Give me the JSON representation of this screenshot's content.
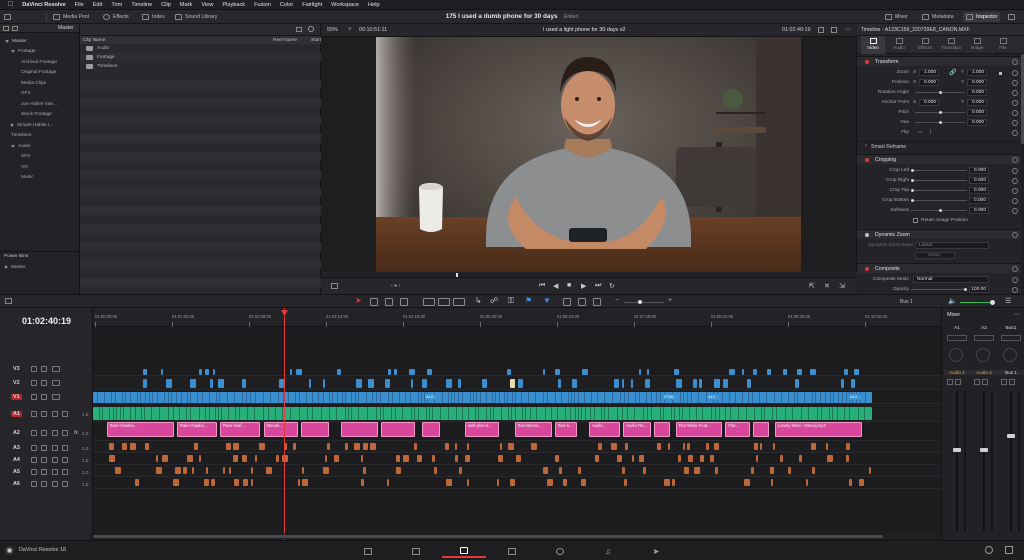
{
  "menubar": {
    "app": "DaVinci Resolve",
    "items": [
      "File",
      "Edit",
      "Trim",
      "Timeline",
      "Clip",
      "Mark",
      "View",
      "Playback",
      "Fusion",
      "Color",
      "Fairlight",
      "Workspace",
      "Help"
    ]
  },
  "toolbar": {
    "media_pool": "Media Pool",
    "effects": "Effects",
    "index": "Index",
    "sound_library": "Sound Library",
    "project_title": "175 I used a dumb phone for 30 days",
    "project_status": "Edited",
    "mixer": "Mixer",
    "metadata": "Metadata",
    "inspector": "Inspector"
  },
  "bins": {
    "header": "Master",
    "tree": [
      {
        "label": "Master",
        "level": 0,
        "open": true
      },
      {
        "label": "Footage",
        "level": 1,
        "open": true
      },
      {
        "label": "Archival Footage",
        "level": 2
      },
      {
        "label": "Original Footage",
        "level": 2
      },
      {
        "label": "Media Clips",
        "level": 2
      },
      {
        "label": "GFX",
        "level": 2
      },
      {
        "label": "Joe Hollier Inte...",
        "level": 2
      },
      {
        "label": "Stock Footage",
        "level": 2
      },
      {
        "label": "Simple Habits I...",
        "level": 1,
        "open": false
      },
      {
        "label": "Timelines",
        "level": 1
      },
      {
        "label": "Audio",
        "level": 1,
        "open": true
      },
      {
        "label": "SFX",
        "level": 2
      },
      {
        "label": "VO",
        "level": 2
      },
      {
        "label": "Music",
        "level": 2
      }
    ],
    "power_bins_label": "Power Bins",
    "power_bins_master": "Master"
  },
  "pool": {
    "columns": [
      "Clip Name",
      "Reel Name",
      "Start"
    ],
    "rows": [
      "Audio",
      "Footage",
      "Timelines"
    ]
  },
  "viewer": {
    "zoom": "55%",
    "timecode_left": "00:10:51:11",
    "timeline_name": "I used a light phone for 30 days v2",
    "timecode_right": "01:02:40:19",
    "zoom_options": "Fit"
  },
  "inspector": {
    "clip_title": "Timeline - A123C159_220729E8_CANON.MXF",
    "tabs": [
      "Video",
      "Audio",
      "Effects",
      "Transition",
      "Image",
      "File"
    ],
    "transform": {
      "header": "Transform",
      "zoom_label": "Zoom",
      "zoom_x": "1.000",
      "zoom_y": "1.000",
      "position_label": "Position",
      "pos_x": "0.000",
      "pos_y": "0.000",
      "rotation_label": "Rotation Angle",
      "rotation": "0.000",
      "anchor_label": "Anchor Point",
      "anchor_x": "0.000",
      "anchor_y": "0.000",
      "pitch_label": "Pitch",
      "pitch": "0.000",
      "yaw_label": "Yaw",
      "yaw": "0.000",
      "flip_label": "Flip"
    },
    "smart_reframe": "Smart Reframe",
    "cropping": {
      "header": "Cropping",
      "crop_left_label": "Crop Left",
      "crop_left": "0.000",
      "crop_right_label": "Crop Right",
      "crop_right": "0.000",
      "crop_top_label": "Crop Top",
      "crop_top": "0.000",
      "crop_bottom_label": "Crop Bottom",
      "crop_bottom": "0.000",
      "softness_label": "Softness",
      "softness": "0.000",
      "retain_label": "Retain Image Position"
    },
    "dynamic_zoom": {
      "header": "Dynamic Zoom",
      "ease_label": "Dynamic Zoom Ease",
      "ease_value": "Linear",
      "swap": "Swap"
    },
    "composite": {
      "header": "Composite",
      "mode_label": "Composite Mode",
      "mode_value": "Normal",
      "opacity_label": "Opacity",
      "opacity": "100.00"
    }
  },
  "timeline": {
    "timecode": "01:02:40:19",
    "bus_label": "Bus 1",
    "ruler": [
      "01:00:00:00",
      "01:01:04:00",
      "01:02:08:00",
      "01:03:12:00",
      "01:04:16:00",
      "01:05:20:00",
      "01:06:24:00",
      "01:07:28:00",
      "01:08:32:00",
      "01:09:36:00",
      "01:10:40:00"
    ],
    "tracks": [
      {
        "name": "V3",
        "kind": "video",
        "level": ""
      },
      {
        "name": "V2",
        "kind": "video",
        "level": ""
      },
      {
        "name": "V1",
        "kind": "video",
        "level": "",
        "active": true
      },
      {
        "name": "A1",
        "kind": "audio",
        "level": "1.0",
        "active": true
      },
      {
        "name": "A2",
        "kind": "audio",
        "level": "2.0"
      },
      {
        "name": "A3",
        "kind": "audio",
        "level": "2.0"
      },
      {
        "name": "A4",
        "kind": "audio",
        "level": "1.0"
      },
      {
        "name": "A5",
        "kind": "audio",
        "level": "1.0"
      },
      {
        "name": "A6",
        "kind": "audio",
        "level": "1.0"
      }
    ],
    "v1_labels": [
      "A12...",
      "2758...",
      "A12...",
      "A12..."
    ],
    "a2_clips": [
      {
        "label": "Rare-chaafai...",
        "start": 0.022,
        "end": 0.13
      },
      {
        "label": "Rare-chaafai...",
        "start": 0.135,
        "end": 0.2
      },
      {
        "label": "Rare-chaf...",
        "start": 0.205,
        "end": 0.27
      },
      {
        "label": "Monak...",
        "start": 0.275,
        "end": 0.33
      },
      {
        "label": "",
        "start": 0.335,
        "end": 0.38
      },
      {
        "label": "",
        "start": 0.4,
        "end": 0.46
      },
      {
        "label": "",
        "start": 0.465,
        "end": 0.52
      },
      {
        "label": "",
        "start": 0.53,
        "end": 0.56
      },
      {
        "label": "well-plus-d...",
        "start": 0.6,
        "end": 0.655
      },
      {
        "label": "Ras Banno...",
        "start": 0.68,
        "end": 0.74
      },
      {
        "label": "Ras-b...",
        "start": 0.745,
        "end": 0.78
      },
      {
        "label": "Audio..",
        "start": 0.8,
        "end": 0.85
      },
      {
        "label": "Audio-Ra...",
        "start": 0.855,
        "end": 0.9
      },
      {
        "label": "",
        "start": 0.905,
        "end": 0.93
      },
      {
        "label": "Flat White Feat...",
        "start": 0.94,
        "end": 1.015
      },
      {
        "label": "Flat...",
        "start": 1.02,
        "end": 1.06
      },
      {
        "label": "",
        "start": 1.065,
        "end": 1.09
      },
      {
        "label": "Lonely Mind - Manaij.mp3",
        "start": 1.1,
        "end": 1.24
      }
    ]
  },
  "mixer": {
    "title": "Mixer",
    "strips": [
      {
        "name": "A1",
        "label": "Audio 1"
      },
      {
        "name": "A2",
        "label": "Audio 2"
      },
      {
        "name": "Bus1",
        "label": "Bus 1"
      }
    ]
  },
  "status": {
    "app_version": "DaVinci Resolve 18"
  },
  "colors": {
    "video_clip": "#3a8fd0",
    "audio_a1": "#27b07a",
    "audio_a2": "#d8479b",
    "audio_sfx": "#c0673a",
    "playhead": "#e23a3a",
    "accent_red": "#e0393b"
  }
}
